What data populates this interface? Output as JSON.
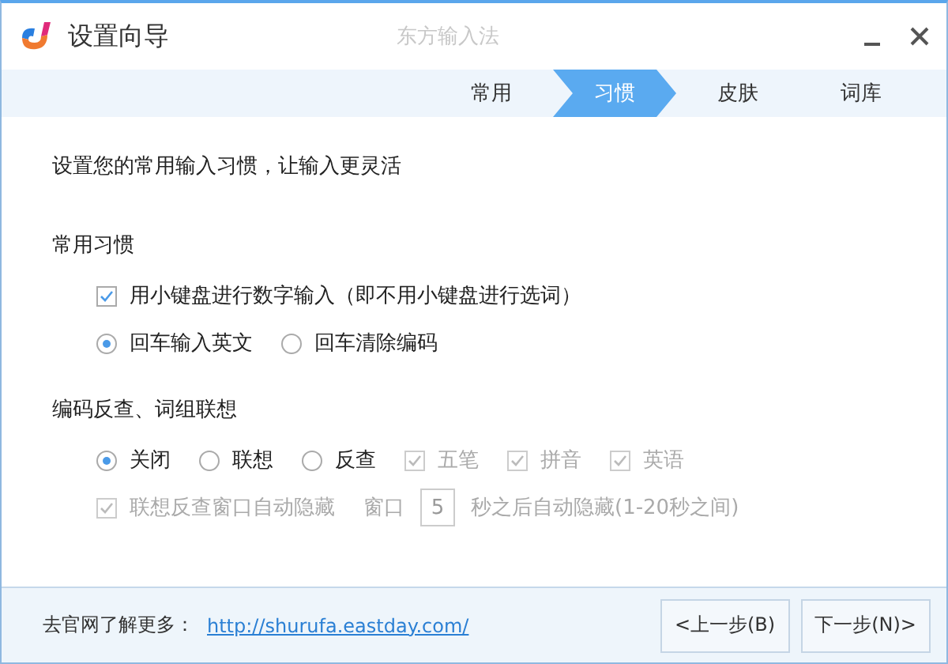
{
  "window": {
    "title": "设置向导",
    "app_name": "东方输入法"
  },
  "steps": [
    {
      "label": "常用",
      "selected": false
    },
    {
      "label": "习惯",
      "selected": true
    },
    {
      "label": "皮肤",
      "selected": false
    },
    {
      "label": "词库",
      "selected": false
    }
  ],
  "intro": "设置您的常用输入习惯，让输入更灵活",
  "sections": [
    {
      "title": "常用习惯",
      "lines": [
        {
          "options": [
            {
              "kind": "checkbox",
              "label": "用小键盘进行数字输入（即不用小键盘进行选词）",
              "checked": true,
              "disabled": false
            }
          ]
        },
        {
          "options": [
            {
              "kind": "radio",
              "label": "回车输入英文",
              "selected": true,
              "disabled": false
            },
            {
              "kind": "radio",
              "label": "回车清除编码",
              "selected": false,
              "disabled": false
            }
          ]
        }
      ]
    },
    {
      "title": "编码反查、词组联想",
      "lines": [
        {
          "options": [
            {
              "kind": "radio",
              "label": "关闭",
              "selected": true,
              "disabled": false
            },
            {
              "kind": "radio",
              "label": "联想",
              "selected": false,
              "disabled": false
            },
            {
              "kind": "radio",
              "label": "反查",
              "selected": false,
              "disabled": false
            },
            {
              "kind": "checkbox",
              "label": "五笔",
              "checked": true,
              "disabled": true
            },
            {
              "kind": "checkbox",
              "label": "拼音",
              "checked": true,
              "disabled": true
            },
            {
              "kind": "checkbox",
              "label": "英语",
              "checked": true,
              "disabled": true
            }
          ]
        },
        {
          "options": [
            {
              "kind": "checkbox",
              "label": "联想反查窗口自动隐藏",
              "checked": true,
              "disabled": true
            },
            {
              "kind": "text",
              "label": "窗口",
              "disabled": true
            },
            {
              "kind": "field",
              "value": "5",
              "disabled": true
            },
            {
              "kind": "text",
              "label": "秒之后自动隐藏(1-20秒之间)",
              "disabled": true
            }
          ]
        }
      ]
    }
  ],
  "footer": {
    "label": "去官网了解更多：",
    "link": "http://shurufa.eastday.com/",
    "buttons": [
      "<上一步(B)",
      "下一步(N)>"
    ]
  }
}
